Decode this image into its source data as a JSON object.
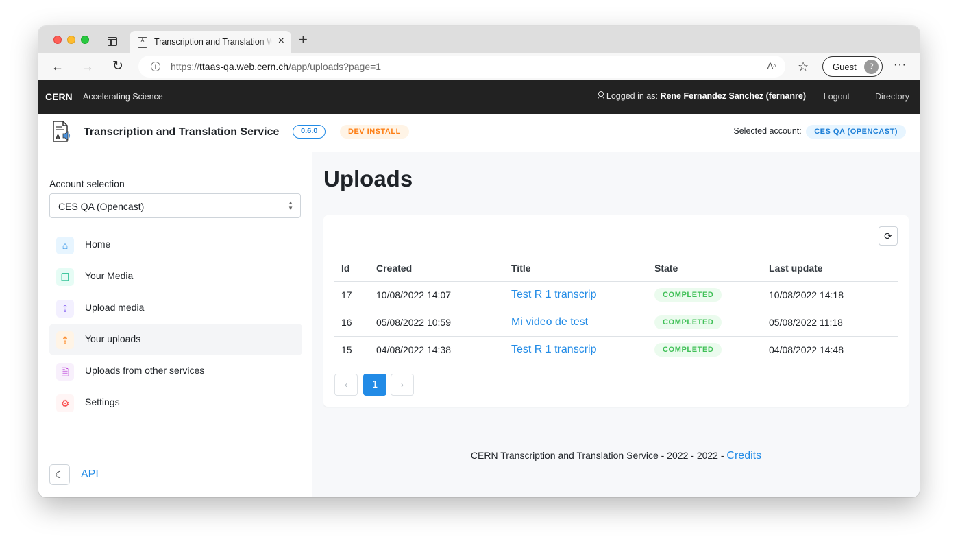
{
  "browser": {
    "tab_title": "Transcription and Translation Web",
    "url_scheme": "https://",
    "url_host": "ttaas-qa.web.cern.ch",
    "url_path": "/app/uploads?page=1",
    "profile_label": "Guest"
  },
  "cern_bar": {
    "logo": "CERN",
    "tagline": "Accelerating Science",
    "logged_in_prefix": "Logged in as:",
    "user": "Rene Fernandez Sanchez (fernanre)",
    "logout": "Logout",
    "directory": "Directory"
  },
  "header": {
    "title": "Transcription and Translation Service",
    "version": "0.6.0",
    "env_badge": "DEV INSTALL",
    "selected_account_label": "Selected account:",
    "selected_account": "CES QA (OPENCAST)"
  },
  "sidebar": {
    "account_label": "Account selection",
    "account_value": "CES QA (Opencast)",
    "items": [
      {
        "label": "Home",
        "icon": "home-icon"
      },
      {
        "label": "Your Media",
        "icon": "files-icon"
      },
      {
        "label": "Upload media",
        "icon": "upload-icon"
      },
      {
        "label": "Your uploads",
        "icon": "file-upload-icon"
      },
      {
        "label": "Uploads from other services",
        "icon": "file-info-icon"
      },
      {
        "label": "Settings",
        "icon": "gear-icon"
      }
    ],
    "api_link": "API"
  },
  "main": {
    "page_title": "Uploads",
    "columns": [
      "Id",
      "Created",
      "Title",
      "State",
      "Last update"
    ],
    "rows": [
      {
        "id": "17",
        "created": "10/08/2022 14:07",
        "title": "Test R 1 transcrip",
        "state": "COMPLETED",
        "updated": "10/08/2022 14:18"
      },
      {
        "id": "16",
        "created": "05/08/2022 10:59",
        "title": "Mi video de test",
        "state": "COMPLETED",
        "updated": "05/08/2022 11:18"
      },
      {
        "id": "15",
        "created": "04/08/2022 14:38",
        "title": "Test R 1 transcrip",
        "state": "COMPLETED",
        "updated": "04/08/2022 14:48"
      }
    ],
    "pagination": {
      "current": "1"
    },
    "footer_text": "CERN Transcription and Translation Service - 2022 - 2022 -",
    "footer_link": "Credits"
  },
  "colors": {
    "accent": "#228be6",
    "cern_bar": "#222222",
    "completed": "#40c057",
    "dev_badge": "#fd7e14"
  }
}
